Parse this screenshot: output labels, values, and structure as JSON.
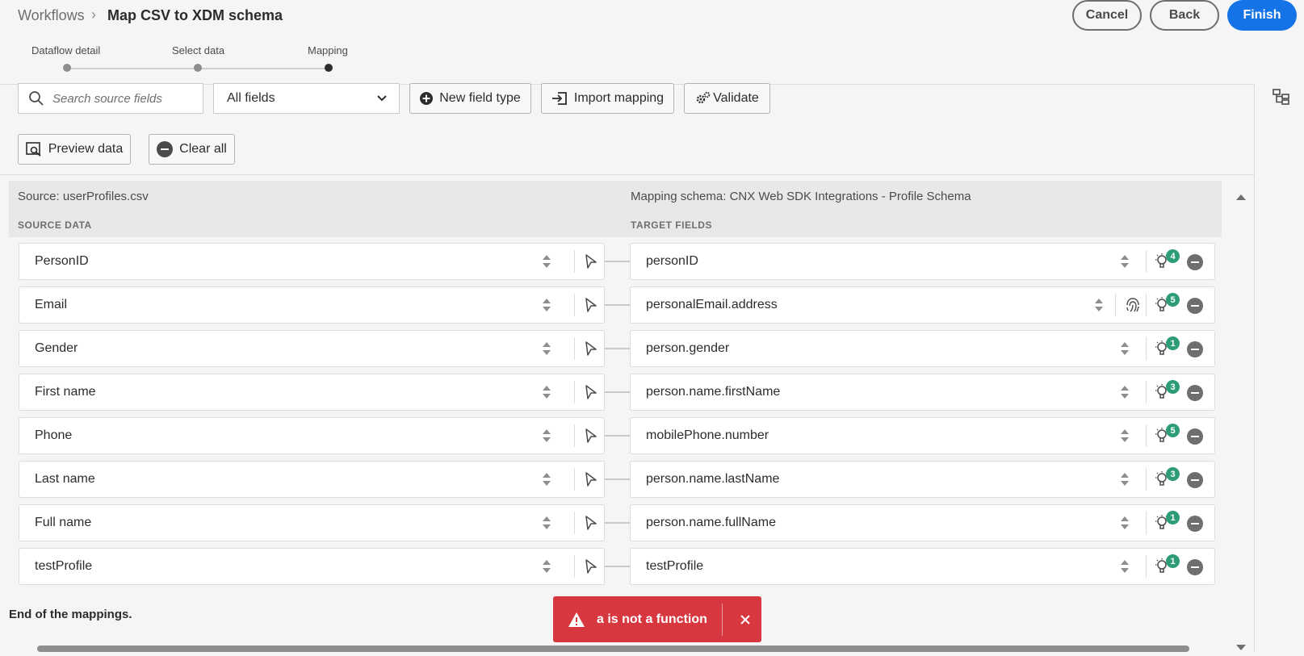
{
  "header": {
    "breadcrumb_parent": "Workflows",
    "breadcrumb_separator": "›",
    "title": "Map CSV to XDM schema",
    "cancel_label": "Cancel",
    "back_label": "Back",
    "finish_label": "Finish"
  },
  "steps": [
    {
      "label": "Dataflow detail"
    },
    {
      "label": "Select data"
    },
    {
      "label": "Mapping",
      "active": true
    }
  ],
  "toolbar": {
    "search_placeholder": "Search source fields",
    "filter_value": "All fields",
    "new_field_type_label": "New field type",
    "import_mapping_label": "Import mapping",
    "validate_label": "Validate",
    "preview_data_label": "Preview data",
    "clear_all_label": "Clear all"
  },
  "mapping": {
    "source_title": "Source: userProfiles.csv",
    "target_title": "Mapping schema: CNX Web SDK Integrations - Profile Schema",
    "source_heading": "SOURCE DATA",
    "target_heading": "TARGET FIELDS",
    "rows": [
      {
        "source": "PersonID",
        "target": "personID",
        "recommendations": "4"
      },
      {
        "source": "Email",
        "target": "personalEmail.address",
        "recommendations": "5",
        "identity": true
      },
      {
        "source": "Gender",
        "target": "person.gender",
        "recommendations": "1"
      },
      {
        "source": "First name",
        "target": "person.name.firstName",
        "recommendations": "3"
      },
      {
        "source": "Phone",
        "target": "mobilePhone.number",
        "recommendations": "5"
      },
      {
        "source": "Last name",
        "target": "person.name.lastName",
        "recommendations": "3"
      },
      {
        "source": "Full name",
        "target": "person.name.fullName",
        "recommendations": "1"
      },
      {
        "source": "testProfile",
        "target": "testProfile",
        "recommendations": "1"
      }
    ],
    "end_text": "End of the mappings."
  },
  "toast": {
    "message": "a is not a function",
    "color": "#d7373f"
  },
  "colors": {
    "accent": "#1473e6",
    "badge": "#2d9d78"
  }
}
